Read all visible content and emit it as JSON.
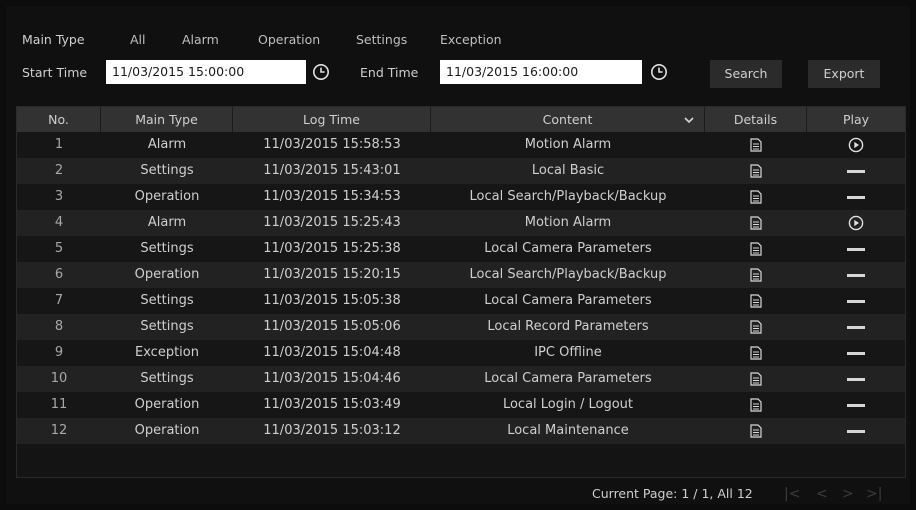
{
  "filters": {
    "main_type_label": "Main Type",
    "options": [
      "All",
      "Alarm",
      "Operation",
      "Settings",
      "Exception"
    ],
    "start_time_label": "Start Time",
    "start_time_value": "11/03/2015 15:00:00",
    "end_time_label": "End Time",
    "end_time_value": "11/03/2015 16:00:00",
    "search_label": "Search",
    "export_label": "Export"
  },
  "table": {
    "headers": [
      "No.",
      "Main Type",
      "Log Time",
      "Content",
      "Details",
      "Play"
    ],
    "rows": [
      {
        "no": "1",
        "type": "Alarm",
        "time": "11/03/2015 15:58:53",
        "content": "Motion Alarm",
        "play": "play-icon"
      },
      {
        "no": "2",
        "type": "Settings",
        "time": "11/03/2015 15:43:01",
        "content": "Local Basic",
        "play": "dash-icon"
      },
      {
        "no": "3",
        "type": "Operation",
        "time": "11/03/2015 15:34:53",
        "content": "Local Search/Playback/Backup",
        "play": "dash-icon"
      },
      {
        "no": "4",
        "type": "Alarm",
        "time": "11/03/2015 15:25:43",
        "content": "Motion Alarm",
        "play": "play-icon"
      },
      {
        "no": "5",
        "type": "Settings",
        "time": "11/03/2015 15:25:38",
        "content": "Local Camera Parameters",
        "play": "dash-icon"
      },
      {
        "no": "6",
        "type": "Operation",
        "time": "11/03/2015 15:20:15",
        "content": "Local Search/Playback/Backup",
        "play": "dash-icon"
      },
      {
        "no": "7",
        "type": "Settings",
        "time": "11/03/2015 15:05:38",
        "content": "Local Camera Parameters",
        "play": "dash-icon"
      },
      {
        "no": "8",
        "type": "Settings",
        "time": "11/03/2015 15:05:06",
        "content": "Local Record Parameters",
        "play": "dash-icon"
      },
      {
        "no": "9",
        "type": "Exception",
        "time": "11/03/2015 15:04:48",
        "content": "IPC Offline",
        "play": "dash-icon"
      },
      {
        "no": "10",
        "type": "Settings",
        "time": "11/03/2015 15:04:46",
        "content": "Local Camera Parameters",
        "play": "dash-icon"
      },
      {
        "no": "11",
        "type": "Operation",
        "time": "11/03/2015 15:03:49",
        "content": "Local Login / Logout",
        "play": "dash-icon"
      },
      {
        "no": "12",
        "type": "Operation",
        "time": "11/03/2015 15:03:12",
        "content": "Local Maintenance",
        "play": "dash-icon"
      }
    ]
  },
  "footer": {
    "page_info": "Current Page: 1 / 1, All 12",
    "nav_first": "|<",
    "nav_prev": "<",
    "nav_next": ">",
    "nav_last": ">|"
  }
}
